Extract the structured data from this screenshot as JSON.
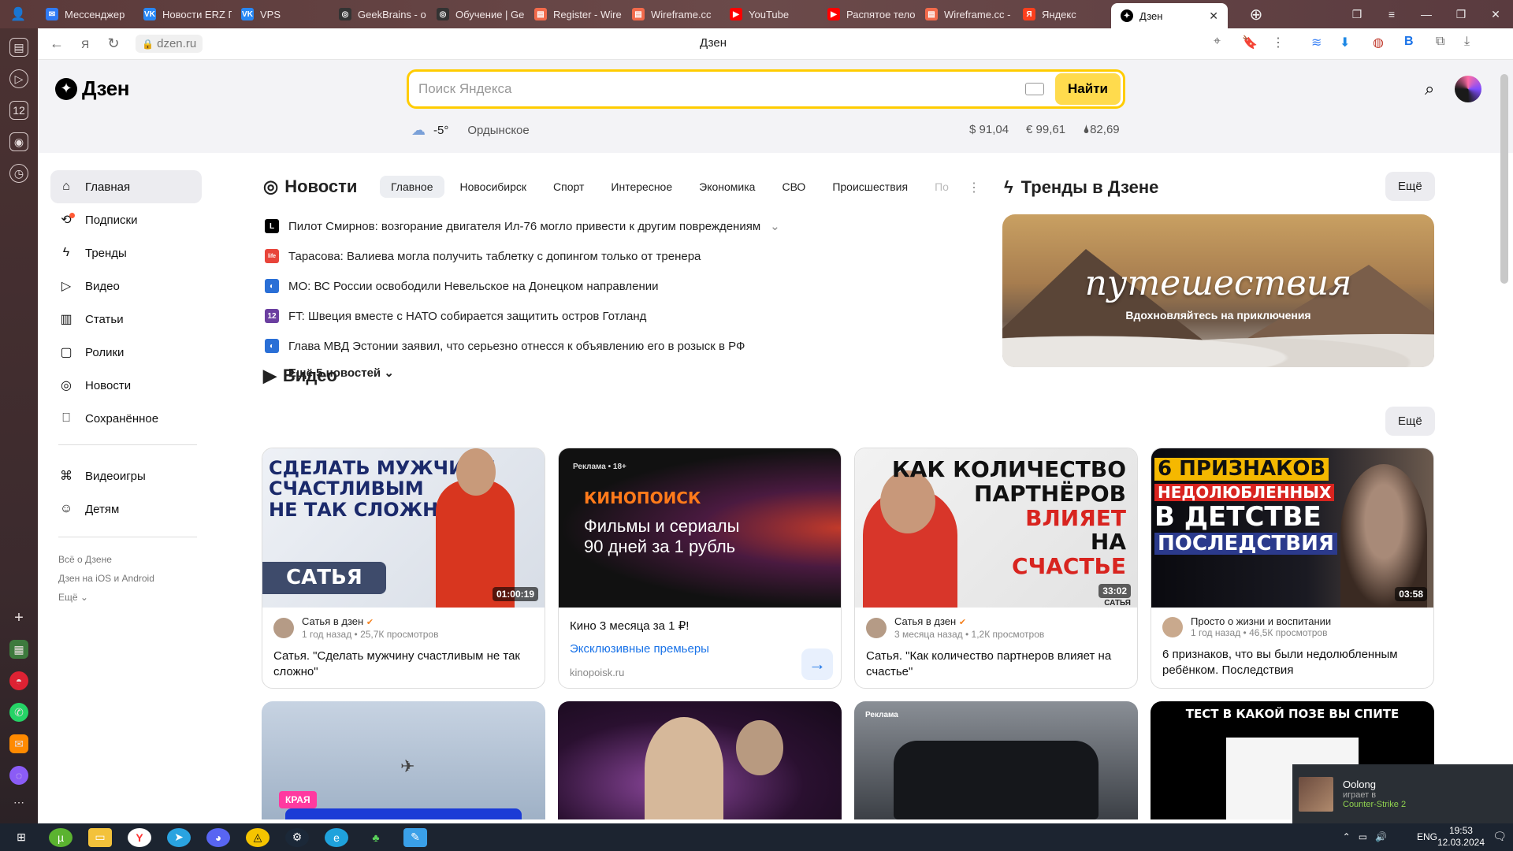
{
  "browser": {
    "tabs": [
      {
        "label": "Мессенджер",
        "color": "#2f7bf6",
        "glyph": "✉"
      },
      {
        "label": "Новости ERZ Г",
        "color": "#2787f5",
        "glyph": "VK"
      },
      {
        "label": "VPS",
        "color": "#2787f5",
        "glyph": "VK"
      },
      {
        "label": "GeekBrains - о",
        "color": "#333333",
        "glyph": "◎"
      },
      {
        "label": "Обучение | Ge",
        "color": "#333333",
        "glyph": "◎"
      },
      {
        "label": "Register - Wire",
        "color": "#f26a4b",
        "glyph": "▤"
      },
      {
        "label": "Wireframe.cc",
        "color": "#f26a4b",
        "glyph": "▤"
      },
      {
        "label": "YouTube",
        "color": "#ff0000",
        "glyph": "▶"
      },
      {
        "label": "Распятое тело",
        "color": "#ff0000",
        "glyph": "▶"
      },
      {
        "label": "Wireframe.cc -",
        "color": "#f26a4b",
        "glyph": "▤"
      },
      {
        "label": "Яндекс",
        "color": "#fc3f1d",
        "glyph": "Я"
      }
    ],
    "active_tab": {
      "label": "Дзен"
    },
    "url": "dzen.ru",
    "page_title": "Дзен"
  },
  "header": {
    "logo": "Дзен",
    "search_placeholder": "Поиск Яндекса",
    "search_button": "Найти",
    "weather": {
      "temp": "-5°",
      "city": "Ордынское"
    },
    "rates": [
      {
        "label": "$ 91,04"
      },
      {
        "label": "€ 99,61"
      },
      {
        "label": "🌢82,69"
      }
    ]
  },
  "sidebar": {
    "items": [
      {
        "label": "Главная",
        "icon": "home-icon",
        "glyph": "⌂"
      },
      {
        "label": "Подписки",
        "icon": "subscriptions-icon",
        "glyph": "⟲"
      },
      {
        "label": "Тренды",
        "icon": "lightning-icon",
        "glyph": "ϟ"
      },
      {
        "label": "Видео",
        "icon": "play-icon",
        "glyph": "▷"
      },
      {
        "label": "Статьи",
        "icon": "book-icon",
        "glyph": "▥"
      },
      {
        "label": "Ролики",
        "icon": "shorts-icon",
        "glyph": "▢"
      },
      {
        "label": "Новости",
        "icon": "news-icon",
        "glyph": "◎"
      },
      {
        "label": "Сохранённое",
        "icon": "bookmark-icon",
        "glyph": "⎕"
      }
    ],
    "extra_items": [
      {
        "label": "Видеоигры",
        "icon": "gamepad-icon",
        "glyph": "⌘"
      },
      {
        "label": "Детям",
        "icon": "kids-icon",
        "glyph": "☺"
      }
    ],
    "footer": [
      "Всё о Дзене",
      "Дзен на iOS и Android",
      "Ещё"
    ]
  },
  "news": {
    "title": "Новости",
    "tabs": [
      "Главное",
      "Новосибирск",
      "Спорт",
      "Интересное",
      "Экономика",
      "СВО",
      "Происшествия",
      "По"
    ],
    "items": [
      {
        "text": "Пилот Смирнов: возгорание двигателя Ил-76 могло привести к другим повреждениям",
        "src_color": "#000000",
        "src_glyph": "L"
      },
      {
        "text": "Тарасова: Валиева могла получить таблетку с допингом только от тренера",
        "src_color": "#e8443a",
        "src_glyph": "life"
      },
      {
        "text": "МО: ВС России освободили Невельское на Донецком направлении",
        "src_color": "#2a6fd6",
        "src_glyph": "◐"
      },
      {
        "text": "FT: Швеция вместе с НАТО собирается защитить остров Готланд",
        "src_color": "#6b3fa0",
        "src_glyph": "12"
      },
      {
        "text": "Глава МВД Эстонии заявил, что серьезно отнесся к объявлению его в розыск в РФ",
        "src_color": "#2a6fd6",
        "src_glyph": "◐"
      }
    ],
    "more": "Ещё 5 новостей"
  },
  "trends": {
    "title": "Тренды в Дзене",
    "more": "Ещё",
    "card_title": "путешествия",
    "card_subtitle": "Вдохновляйтесь на приключения"
  },
  "video": {
    "title": "Видео",
    "more": "Ещё",
    "cards": [
      {
        "thumb_lines": [
          "СДЕЛАТЬ МУЖЧИНУ",
          "СЧАСТЛИВЫМ",
          "НЕ ТАК СЛОЖНО"
        ],
        "badge": "САТЬЯ",
        "duration": "01:00:19",
        "channel": "Сатья в дзен",
        "meta": "1 год назад • 25,7К просмотров",
        "title": "Сатья. \"Сделать мужчину счастливым не так сложно\""
      },
      {
        "ad_label": "Реклама • 18+",
        "brand": "КИНОПОИСК",
        "thumb_lines": [
          "Фильмы и сериалы",
          "90 дней за 1 рубль"
        ],
        "title": "Кино 3 месяца за 1 ₽!",
        "link": "Эксклюзивные премьеры",
        "domain": "kinopoisk.ru"
      },
      {
        "thumb_lines": [
          "КАК КОЛИЧЕСТВО",
          "ПАРТНЁРОВ",
          "ВЛИЯЕТ",
          "НА",
          "СЧАСТЬЕ"
        ],
        "duration": "33:02",
        "duration_sub": "САТЬЯ",
        "channel": "Сатья в дзен",
        "meta": "3 месяца назад • 1,2К просмотров",
        "title": "Сатья. \"Как количество партнеров влияет на счастье\""
      },
      {
        "thumb_lines": [
          "6 ПРИЗНАКОВ",
          "НЕДОЛЮБЛЕННЫХ",
          "В ДЕТСТВЕ",
          "ПОСЛЕДСТВИЯ"
        ],
        "duration": "03:58",
        "channel": "Просто о жизни и воспитании",
        "meta": "1 год назад • 46,5К просмотров",
        "title": "6 признаков, что вы были недолюбленным ребёнком. Последствия"
      }
    ],
    "row2": [
      {
        "label": "КРАЯ"
      },
      {
        "label": ""
      },
      {
        "label": "Реклама"
      },
      {
        "label": "ТЕСТ В КАКОЙ ПОЗЕ ВЫ СПИТЕ"
      }
    ]
  },
  "notification": {
    "name": "Oolong",
    "line": "играет в",
    "game": "Counter-Strike 2"
  },
  "taskbar": {
    "lang": "ENG",
    "time": "19:53",
    "date": "12.03.2024"
  }
}
